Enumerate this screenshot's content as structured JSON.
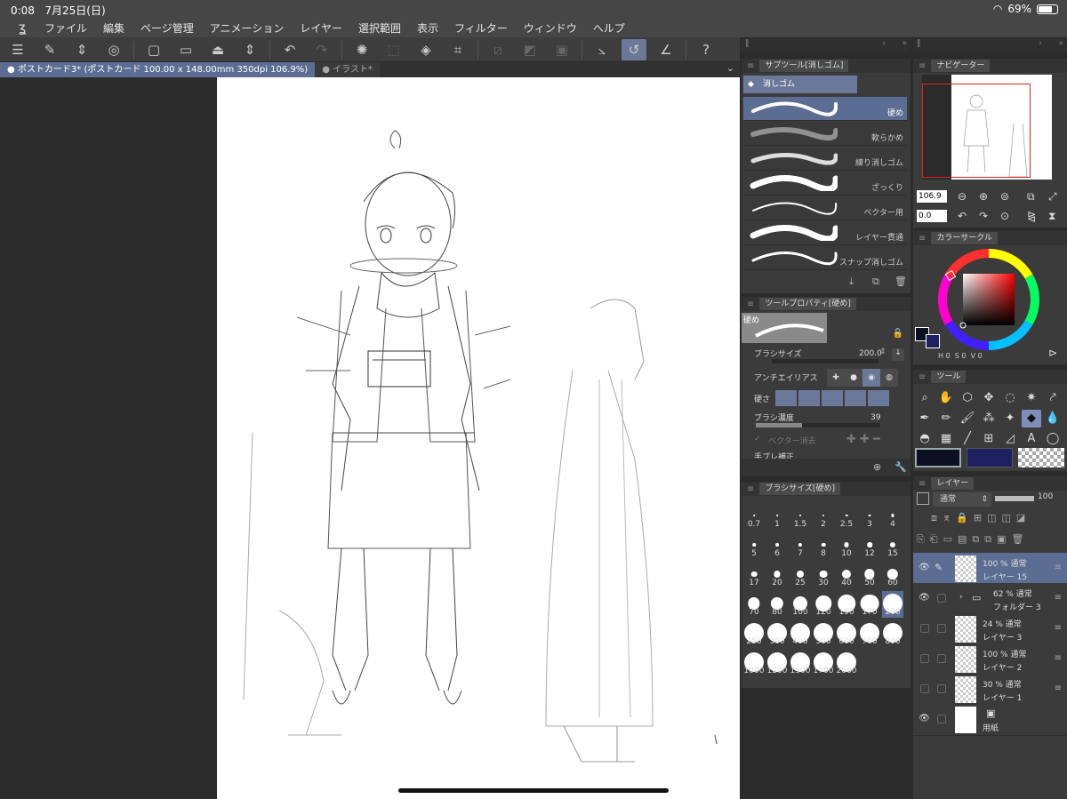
{
  "status": {
    "time": "0:08",
    "date": "7月25日(日)",
    "battery": "69%"
  },
  "menu": [
    "ファイル",
    "編集",
    "ページ管理",
    "アニメーション",
    "レイヤー",
    "選択範囲",
    "表示",
    "フィルター",
    "ウィンドウ",
    "ヘルプ"
  ],
  "tabs": {
    "active": "● ポストカード3* (ポストカード 100.00 x 148.00mm 350dpi 106.9%)",
    "inactive": "● イラスト*"
  },
  "subtool": {
    "title": "サブツール[消しゴム]",
    "group": "消しゴム",
    "items": [
      "硬め",
      "軟らかめ",
      "練り消しゴム",
      "ざっくり",
      "ベクター用",
      "レイヤー貫通",
      "スナップ消しゴム"
    ]
  },
  "toolprop": {
    "title": "ツールプロパティ[硬め]",
    "preset": "硬め",
    "brush_size_label": "ブラシサイズ",
    "brush_size_value": "200.0",
    "antialias_label": "アンチエイリアス",
    "hardness_label": "硬さ",
    "density_label": "ブラシ濃度",
    "density_value": "39",
    "vector_erase_label": "ベクター消去",
    "cut_label": "手ブレ補正"
  },
  "brushsize": {
    "title": "ブラシサイズ[硬め]",
    "values": [
      "0.7",
      "1",
      "1.5",
      "2",
      "2.5",
      "3",
      "4",
      "5",
      "6",
      "7",
      "8",
      "10",
      "12",
      "15",
      "17",
      "20",
      "25",
      "30",
      "40",
      "50",
      "60",
      "70",
      "80",
      "100",
      "120",
      "150",
      "170",
      "200",
      "250",
      "300",
      "400",
      "500",
      "600",
      "700",
      "800",
      "1000",
      "1200",
      "1500",
      "1700",
      "2000"
    ],
    "selected": "200"
  },
  "navigator": {
    "title": "ナビゲーター",
    "zoom": "106.9",
    "rotation": "0.0"
  },
  "colorcircle": {
    "title": "カラーサークル",
    "h_label": "H",
    "h": "0",
    "s_label": "S",
    "s": "0",
    "v_label": "V",
    "v": "0"
  },
  "tool": {
    "title": "ツール"
  },
  "layers": {
    "title": "レイヤー",
    "blend": "通常",
    "opacity": "100",
    "items": [
      {
        "opacity": "100 % 通常",
        "name": "レイヤー 15"
      },
      {
        "opacity": "62 % 通常",
        "name": "フォルダー 3"
      },
      {
        "opacity": "24 % 通常",
        "name": "レイヤー 3"
      },
      {
        "opacity": "100 % 通常",
        "name": "レイヤー 2"
      },
      {
        "opacity": "30 % 通常",
        "name": "レイヤー 1"
      },
      {
        "opacity": "",
        "name": "用紙"
      }
    ]
  },
  "colors": {
    "accent": "#5c6d93",
    "main_color": "#0d0f22",
    "sub_color": "#1e2060"
  }
}
